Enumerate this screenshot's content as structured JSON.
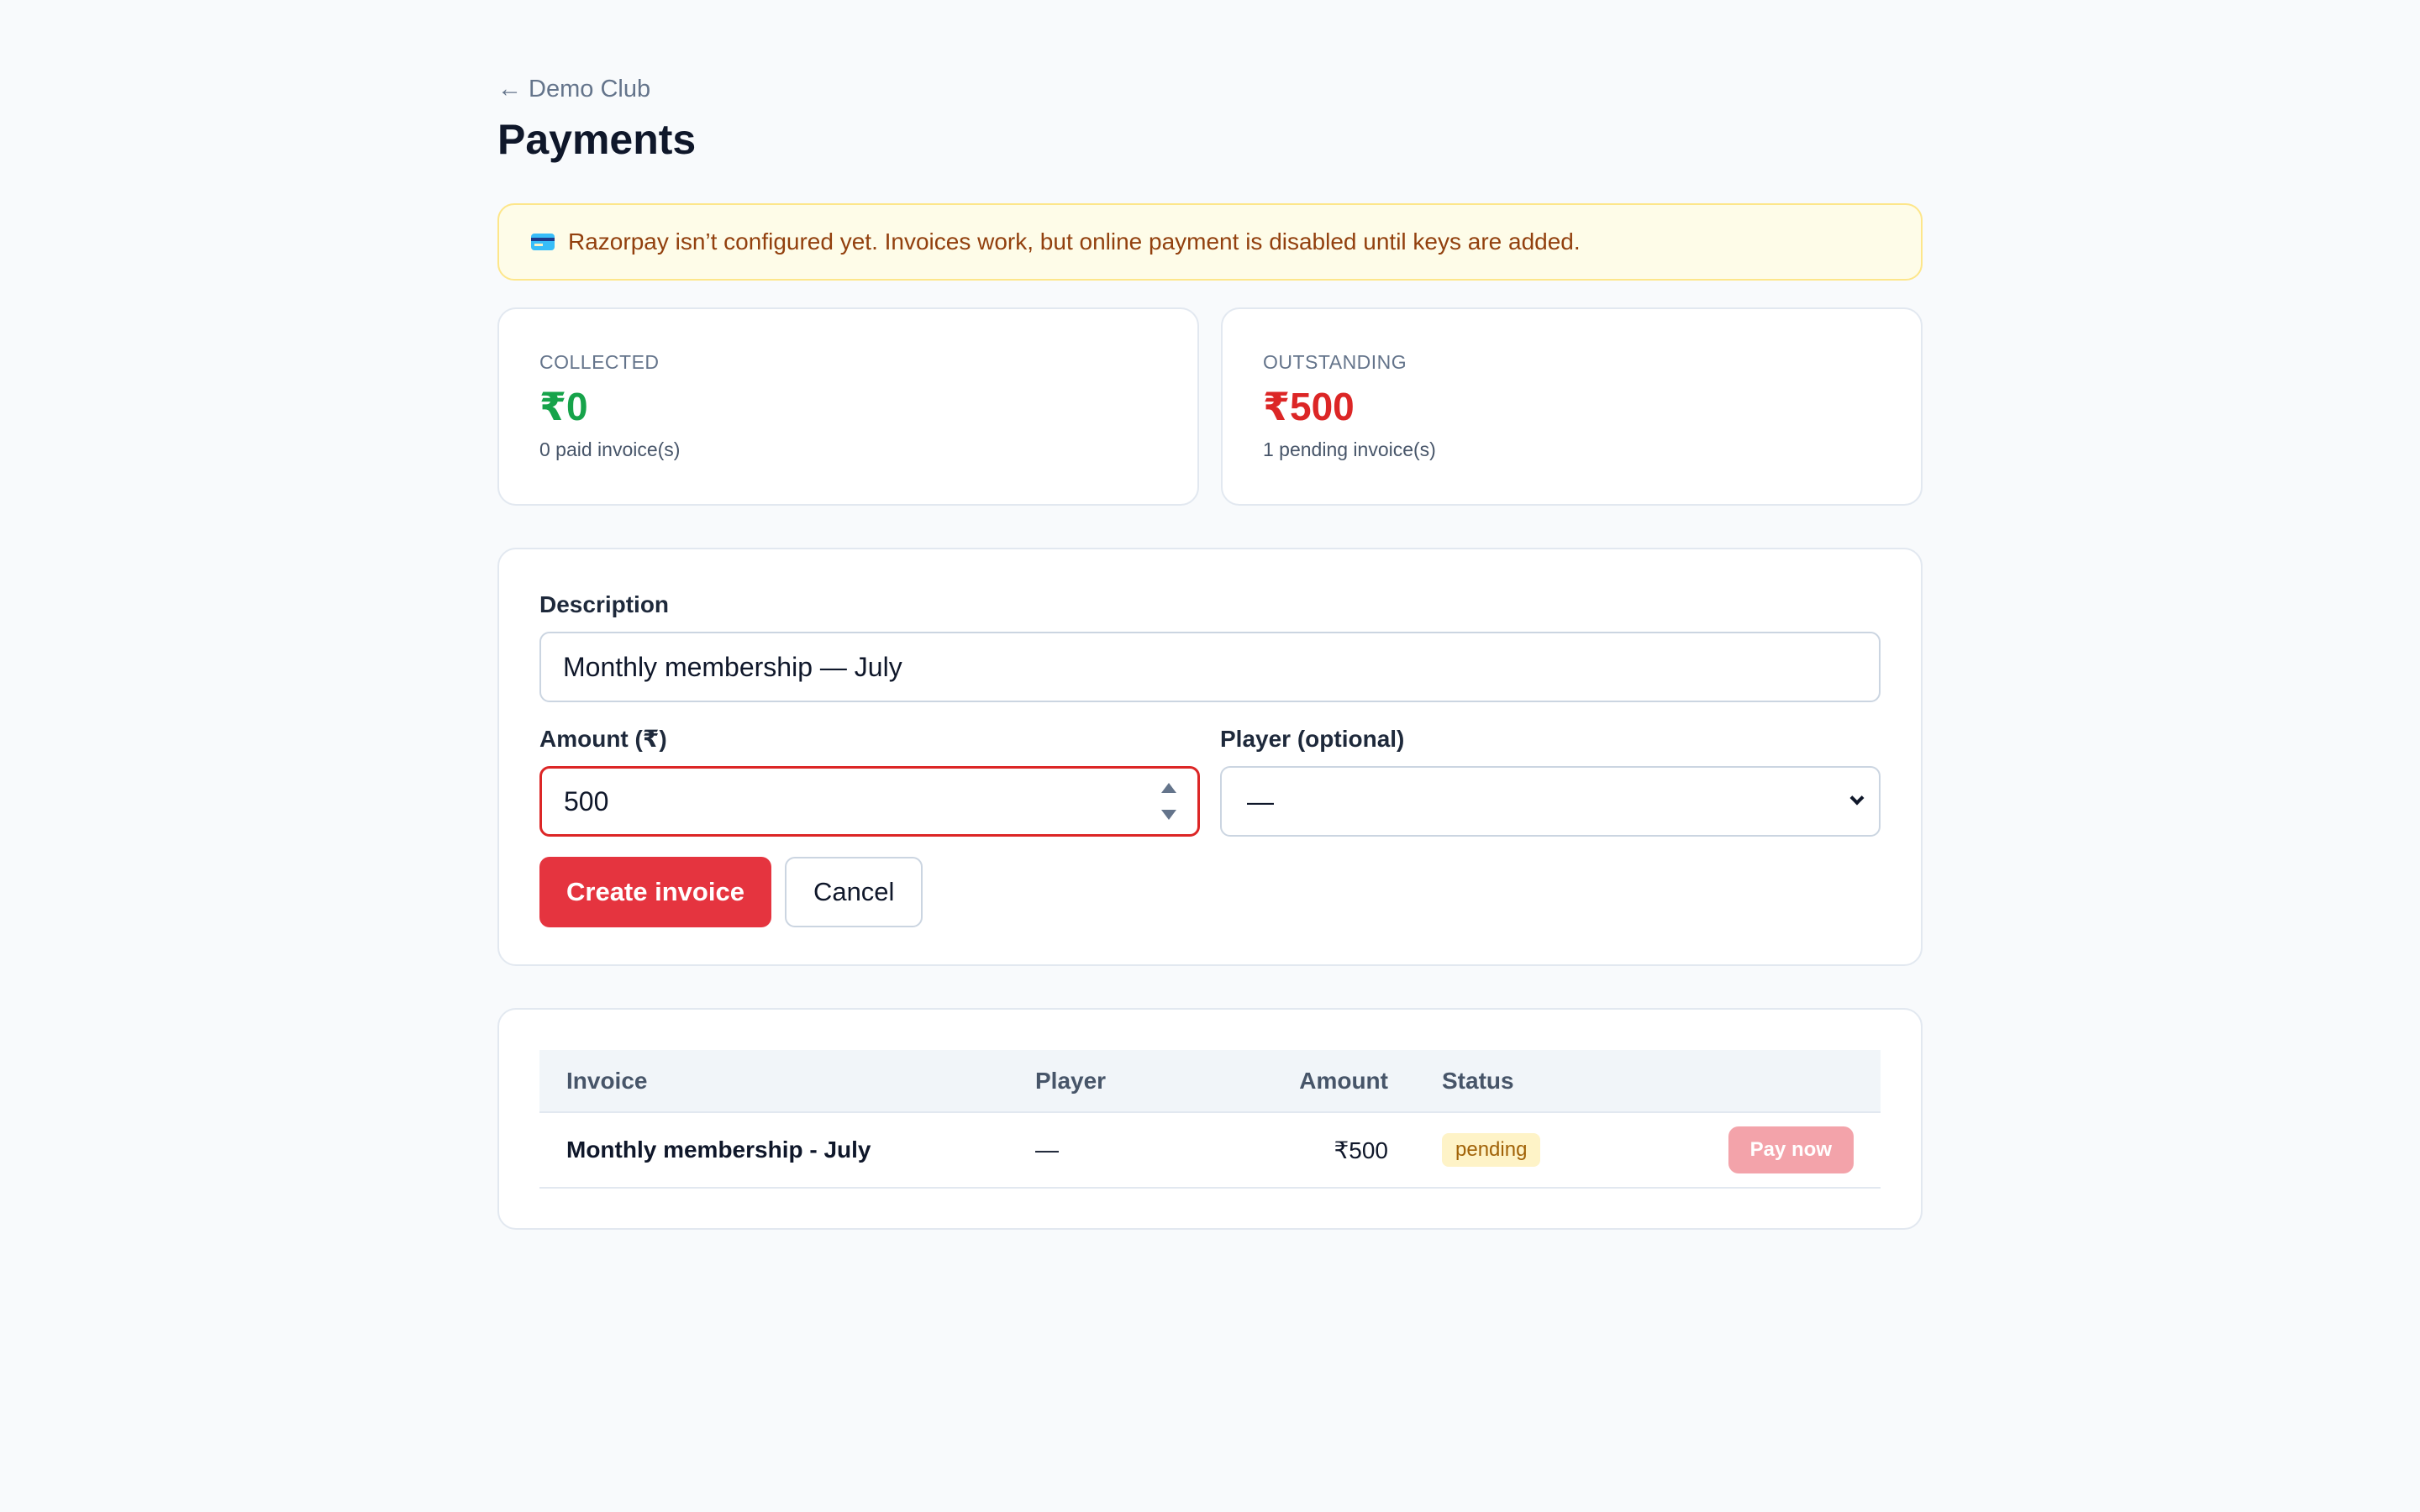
{
  "nav": {
    "back_label": "← Demo Club"
  },
  "page": {
    "title": "Payments"
  },
  "alert": {
    "icon": "credit-card-icon",
    "text": "Razorpay isn’t configured yet. Invoices work, but online payment is disabled until keys are added."
  },
  "stats": {
    "collected": {
      "label": "COLLECTED",
      "value": "₹0",
      "sub": "0 paid invoice(s)",
      "color": "#16a34a"
    },
    "outstanding": {
      "label": "OUTSTANDING",
      "value": "₹500",
      "sub": "1 pending invoice(s)",
      "color": "#dc2626"
    }
  },
  "form": {
    "description_label": "Description",
    "description_value": "Monthly membership — July",
    "amount_label": "Amount (₹)",
    "amount_value": "500",
    "player_label": "Player (optional)",
    "player_value": "—",
    "create_label": "Create invoice",
    "cancel_label": "Cancel"
  },
  "table": {
    "headers": {
      "invoice": "Invoice",
      "player": "Player",
      "amount": "Amount",
      "status": "Status"
    },
    "rows": [
      {
        "invoice": "Monthly membership - July",
        "player": "—",
        "amount": "₹500",
        "status": "pending",
        "action": "Pay now"
      }
    ]
  },
  "colors": {
    "primary": "#e5343f",
    "warning_bg": "#fefce8",
    "pending_badge": "#fef3c7"
  }
}
